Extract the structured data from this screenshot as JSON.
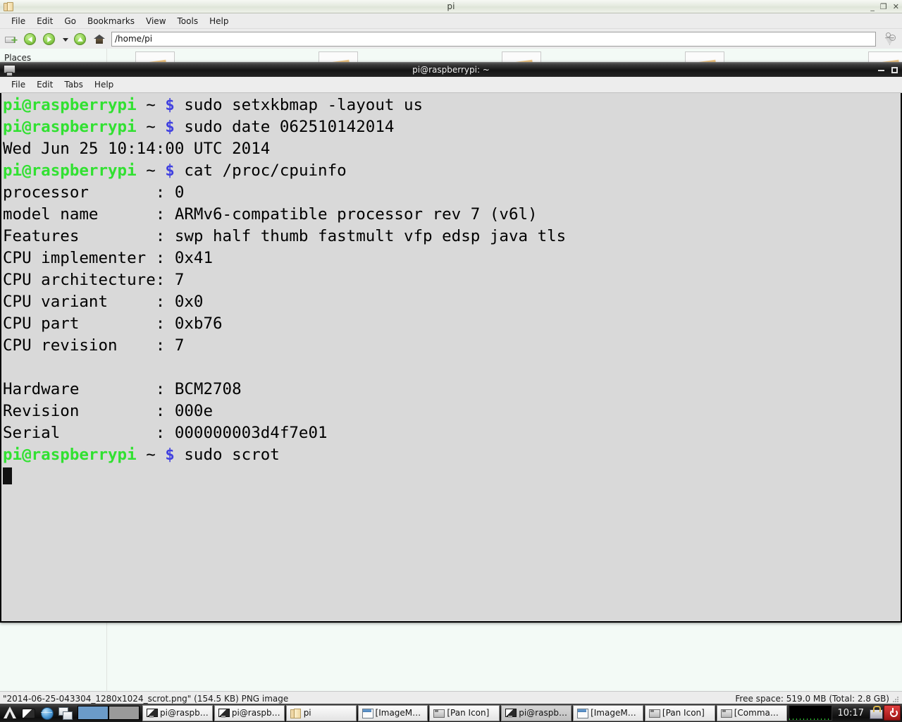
{
  "file_manager": {
    "title": "pi",
    "app_icon": "folder-icon",
    "window_buttons": {
      "minimize": "_",
      "maximize": "❐",
      "close": "✕"
    },
    "menu": [
      "File",
      "Edit",
      "Go",
      "Bookmarks",
      "View",
      "Tools",
      "Help"
    ],
    "toolbar": {
      "new_tab_icon": "new-tab-icon",
      "back_icon": "back-arrow-icon",
      "forward_icon": "forward-arrow-icon",
      "history_icon": "chevron-down-icon",
      "up_icon": "up-arrow-icon",
      "home_icon": "home-icon",
      "go_icon": "go-icon"
    },
    "path": "/home/pi",
    "sidebar_heading": "Places",
    "statusbar": {
      "selection": "\"2014-06-25-043304_1280x1024_scrot.png\" (154.5 KB) PNG image",
      "free_space": "Free space: 519.0 MB (Total: 2.8 GB)"
    }
  },
  "terminal": {
    "title": "pi@raspberrypi: ~",
    "app_icon": "terminal-monitor-icon",
    "window_buttons": {
      "minimize": "_",
      "maximize": "❐"
    },
    "menu": [
      "File",
      "Edit",
      "Tabs",
      "Help"
    ],
    "colors": {
      "prompt_user": "#31e131",
      "prompt_dollar": "#4141e0",
      "text": "#000000",
      "background": "#d9d9d9"
    },
    "prompt": {
      "user_host": "pi@raspberrypi",
      "path": "~",
      "symbol": "$"
    },
    "lines": [
      {
        "type": "prompt",
        "command": "sudo setxkbmap -layout us"
      },
      {
        "type": "prompt",
        "command": "sudo date 062510142014"
      },
      {
        "type": "output",
        "text": "Wed Jun 25 10:14:00 UTC 2014"
      },
      {
        "type": "prompt",
        "command": "cat /proc/cpuinfo"
      },
      {
        "type": "output",
        "text": "processor       : 0"
      },
      {
        "type": "output",
        "text": "model name      : ARMv6-compatible processor rev 7 (v6l)"
      },
      {
        "type": "output",
        "text": "Features        : swp half thumb fastmult vfp edsp java tls"
      },
      {
        "type": "output",
        "text": "CPU implementer : 0x41"
      },
      {
        "type": "output",
        "text": "CPU architecture: 7"
      },
      {
        "type": "output",
        "text": "CPU variant     : 0x0"
      },
      {
        "type": "output",
        "text": "CPU part        : 0xb76"
      },
      {
        "type": "output",
        "text": "CPU revision    : 7"
      },
      {
        "type": "output",
        "text": ""
      },
      {
        "type": "output",
        "text": "Hardware        : BCM2708"
      },
      {
        "type": "output",
        "text": "Revision        : 000e"
      },
      {
        "type": "output",
        "text": "Serial          : 000000003d4f7e01"
      },
      {
        "type": "prompt",
        "command": "sudo scrot"
      },
      {
        "type": "cursor",
        "text": ""
      }
    ]
  },
  "taskbar": {
    "launchers": [
      {
        "name": "menu-icon",
        "label": "Menu"
      },
      {
        "name": "terminal-icon",
        "label": "Terminal"
      },
      {
        "name": "web-browser-icon",
        "label": "Web Browser"
      },
      {
        "name": "show-desktop-icon",
        "label": "Show Desktop"
      }
    ],
    "pager": {
      "desktops": [
        "1",
        "2"
      ],
      "active": 0
    },
    "windows": [
      {
        "label": "pi@raspbe...",
        "icon": "terminal-icon",
        "active": false
      },
      {
        "label": "pi@raspbe...",
        "icon": "terminal-icon",
        "active": false
      },
      {
        "label": "pi",
        "icon": "folder-icon",
        "active": false
      },
      {
        "label": "[ImageMa...",
        "icon": "window-icon",
        "active": false
      },
      {
        "label": "[Pan Icon]",
        "icon": "panel-icon",
        "active": false
      },
      {
        "label": "pi@raspbe...",
        "icon": "terminal-icon",
        "active": true
      },
      {
        "label": "[ImageMa...",
        "icon": "window-icon",
        "active": false
      },
      {
        "label": "[Pan Icon]",
        "icon": "panel-icon",
        "active": false
      },
      {
        "label": "[Commands]",
        "icon": "panel-icon",
        "active": false
      }
    ],
    "tray": {
      "cpu_monitor": "cpu-usage-graph",
      "clock": "10:17",
      "lock_icon": "lock-screen-icon",
      "power_icon": "shutdown-icon"
    }
  }
}
